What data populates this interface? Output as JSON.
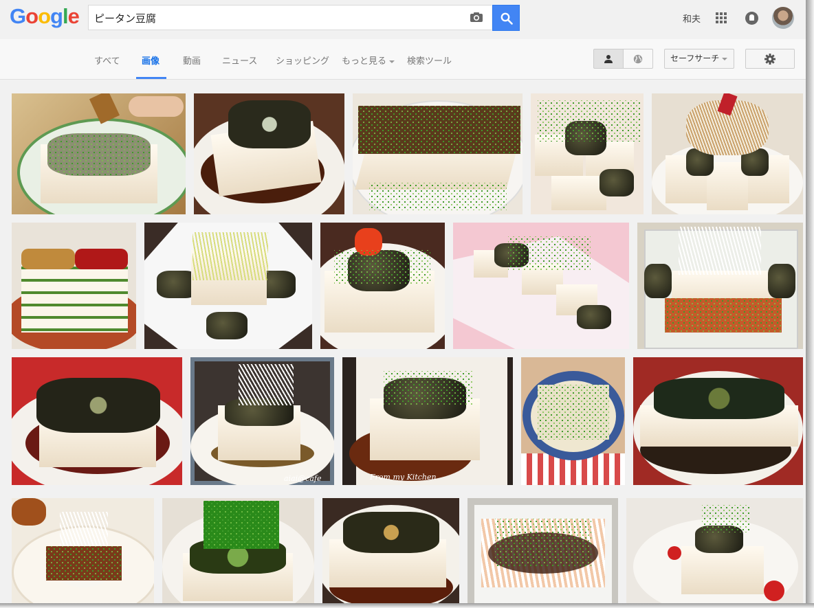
{
  "header": {
    "logo_letters": [
      "G",
      "o",
      "o",
      "g",
      "l",
      "e"
    ],
    "search_value": "ピータン豆腐",
    "user_name": "和夫"
  },
  "nav": {
    "tabs": [
      {
        "label": "すべて",
        "active": false
      },
      {
        "label": "画像",
        "active": true
      },
      {
        "label": "動画",
        "active": false
      },
      {
        "label": "ニュース",
        "active": false
      },
      {
        "label": "ショッピング",
        "active": false
      },
      {
        "label": "もっと見る",
        "active": false
      },
      {
        "label": "検索ツール",
        "active": false
      }
    ],
    "safe_search_label": "セーフサーチ"
  },
  "images": [
    {
      "alt": "image-1"
    },
    {
      "alt": "image-2"
    },
    {
      "alt": "image-3"
    },
    {
      "alt": "image-4"
    },
    {
      "alt": "image-5"
    },
    {
      "alt": "image-6"
    },
    {
      "alt": "image-7"
    },
    {
      "alt": "image-8"
    },
    {
      "alt": "image-9"
    },
    {
      "alt": "image-10"
    },
    {
      "alt": "image-11"
    },
    {
      "alt": "image-12"
    },
    {
      "alt": "image-13"
    },
    {
      "alt": "image-14"
    },
    {
      "alt": "image-15"
    },
    {
      "alt": "image-16"
    },
    {
      "alt": "image-17"
    },
    {
      "alt": "image-18"
    },
    {
      "alt": "image-19"
    },
    {
      "alt": "image-20"
    }
  ],
  "watermarks": {
    "aiai": "aiai@cafe",
    "kitchen": "From my Kitchen"
  },
  "colors": {
    "accent": "#4285f4",
    "active_tab": "#1a73e8",
    "background": "#f1f1f1"
  }
}
